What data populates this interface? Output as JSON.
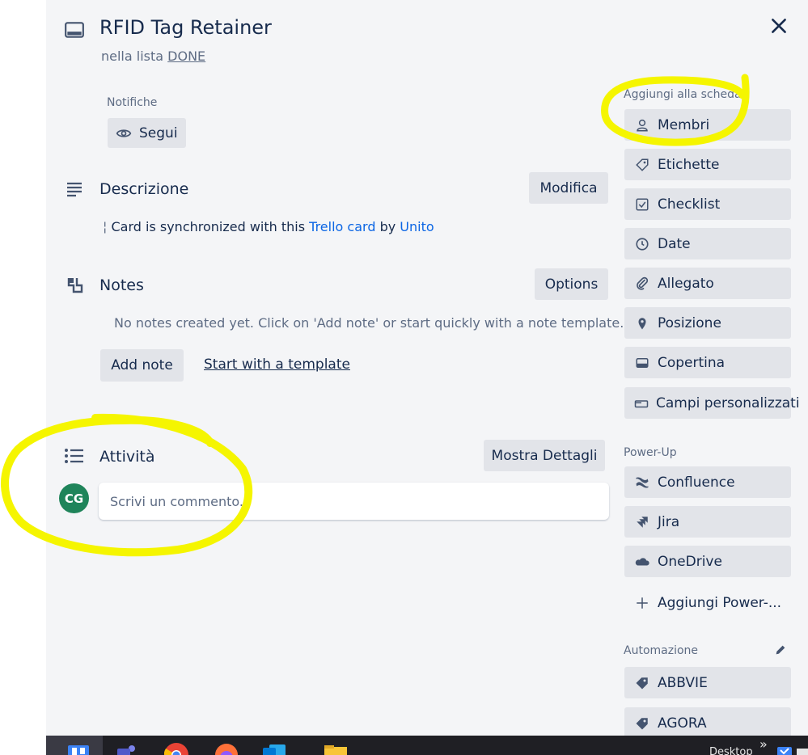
{
  "card": {
    "title": "RFID Tag Retainer",
    "list_prefix": "nella lista",
    "list_name": "DONE"
  },
  "notifications": {
    "label": "Notifiche",
    "follow_label": "Segui"
  },
  "description": {
    "title": "Descrizione",
    "edit_label": "Modifica",
    "prefix_mark": "¦",
    "text_before": "Card is synchronized with this",
    "link1": "Trello card",
    "text_middle": "by",
    "link2": "Unito"
  },
  "notes": {
    "title": "Notes",
    "options_label": "Options",
    "empty_text": "No notes created yet. Click on 'Add note' or start quickly with a note template.",
    "add_label": "Add note",
    "template_label": "Start with a template"
  },
  "activity": {
    "title": "Attività",
    "details_label": "Mostra Dettagli",
    "avatar_initials": "CG",
    "comment_placeholder": "Scrivi un commento..."
  },
  "sidebar": {
    "add_to_card_label": "Aggiungi alla scheda",
    "add_items": [
      {
        "label": "Membri",
        "icon": "person-icon"
      },
      {
        "label": "Etichette",
        "icon": "tag-icon"
      },
      {
        "label": "Checklist",
        "icon": "checkbox-icon"
      },
      {
        "label": "Date",
        "icon": "clock-icon"
      },
      {
        "label": "Allegato",
        "icon": "paperclip-icon"
      },
      {
        "label": "Posizione",
        "icon": "location-pin-icon"
      },
      {
        "label": "Copertina",
        "icon": "card-cover-icon"
      },
      {
        "label": "Campi personalizzati",
        "icon": "custom-fields-icon"
      }
    ],
    "powerups_label": "Power-Up",
    "powerups": [
      {
        "label": "Confluence",
        "icon": "confluence-icon"
      },
      {
        "label": "Jira",
        "icon": "jira-icon"
      },
      {
        "label": "OneDrive",
        "icon": "onedrive-icon"
      }
    ],
    "add_powerup_label": "Aggiungi Power-...",
    "automation_label": "Automazione",
    "automation_items": [
      {
        "label": "ABBVIE",
        "icon": "tag-filled-icon"
      },
      {
        "label": "AGORA",
        "icon": "tag-filled-icon"
      }
    ]
  },
  "taskbar": {
    "desktop_label": "Desktop",
    "overflow_glyph": "»"
  },
  "colors": {
    "card_bg": "#f4f5f7",
    "button_bg": "#e2e4e9",
    "text": "#172b4d",
    "muted": "#5e6c84",
    "link": "#0c66e4",
    "avatar": "#1f845a",
    "highlight": "#f5f500",
    "taskbar": "#1f1f24"
  }
}
